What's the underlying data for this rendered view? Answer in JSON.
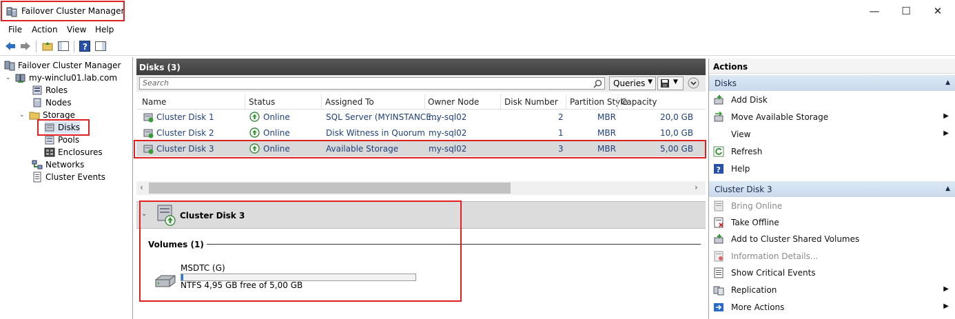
{
  "window": {
    "title": "Failover Cluster Manager",
    "minimize": "—",
    "maximize": "☐",
    "close": "✕"
  },
  "menu": [
    "File",
    "Action",
    "View",
    "Help"
  ],
  "tree": {
    "root": "Failover Cluster Manager",
    "cluster": "my-winclu01.lab.com",
    "items": [
      "Roles",
      "Nodes",
      "Storage",
      "Disks",
      "Pools",
      "Enclosures",
      "Networks",
      "Cluster Events"
    ]
  },
  "center": {
    "header": "Disks (3)",
    "search_placeholder": "Search",
    "queries_label": "Queries",
    "columns": [
      "Name",
      "Status",
      "Assigned To",
      "Owner Node",
      "Disk Number",
      "Partition Style",
      "Capacity"
    ],
    "rows": [
      {
        "name": "Cluster Disk 1",
        "status": "Online",
        "assigned": "SQL Server (MYINSTANCE...",
        "owner": "my-sql02",
        "disknum": "2",
        "partition": "MBR",
        "capacity": "20,0 GB"
      },
      {
        "name": "Cluster Disk 2",
        "status": "Online",
        "assigned": "Disk Witness in Quorum",
        "owner": "my-sql02",
        "disknum": "1",
        "partition": "MBR",
        "capacity": "10,0 GB"
      },
      {
        "name": "Cluster Disk 3",
        "status": "Online",
        "assigned": "Available Storage",
        "owner": "my-sql02",
        "disknum": "3",
        "partition": "MBR",
        "capacity": "5,00 GB"
      }
    ],
    "detail": {
      "title": "Cluster Disk 3",
      "volumes_label": "Volumes (1)",
      "volume_name": "MSDTC (G)",
      "volume_info": "NTFS 4,95 GB free of 5,00 GB",
      "volume_used_fraction": 0.01
    }
  },
  "actions": {
    "title": "Actions",
    "section1": "Disks",
    "section1_items": [
      "Add Disk",
      "Move Available Storage",
      "View",
      "Refresh",
      "Help"
    ],
    "section2": "Cluster Disk 3",
    "section2_items": [
      "Bring Online",
      "Take Offline",
      "Add to Cluster Shared Volumes",
      "Information Details...",
      "Show Critical Events",
      "Replication",
      "More Actions"
    ]
  }
}
